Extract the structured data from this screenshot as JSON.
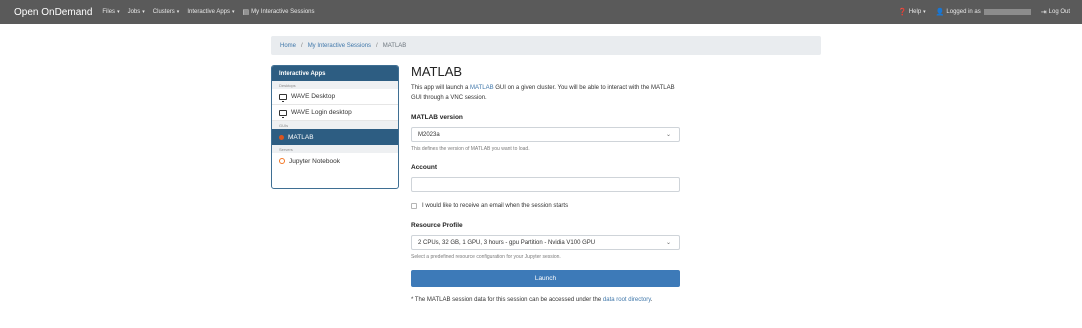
{
  "navbar": {
    "brand": "Open OnDemand",
    "menus": [
      "Files",
      "Jobs",
      "Clusters",
      "Interactive Apps"
    ],
    "sessions_link": "My Interactive Sessions",
    "help": "Help",
    "logged_in": "Logged in as",
    "logout": "Log Out"
  },
  "breadcrumb": {
    "home": "Home",
    "sessions": "My Interactive Sessions",
    "current": "MATLAB",
    "separator": "/"
  },
  "sidebar": {
    "header": "Interactive Apps",
    "groups": [
      {
        "category": "Desktops",
        "items": [
          {
            "label": "WAVE Desktop",
            "icon": "monitor-icon"
          },
          {
            "label": "WAVE Login desktop",
            "icon": "monitor-icon"
          }
        ]
      },
      {
        "category": "GUIs",
        "items": [
          {
            "label": "MATLAB",
            "icon": "matlab-icon",
            "active": true
          }
        ]
      },
      {
        "category": "Servers",
        "items": [
          {
            "label": "Jupyter Notebook",
            "icon": "jupyter-icon"
          }
        ]
      }
    ]
  },
  "form": {
    "title": "MATLAB",
    "description_pre": "This app will launch a ",
    "description_link": "MATLAB",
    "description_post": " GUI on a given cluster. You will be able to interact with the MATLAB GUI through a VNC session.",
    "version_label": "MATLAB version",
    "version_value": "M2023a",
    "version_help": "This defines the version of MATLAB you want to load.",
    "account_label": "Account",
    "account_value": "",
    "email_checkbox": "I would like to receive an email when the session starts",
    "profile_label": "Resource Profile",
    "profile_value": "2 CPUs, 32 GB, 1 GPU, 3 hours - gpu Partition - Nvidia V100 GPU",
    "profile_help": "Select a predefined resource configuration for your Jupyter session.",
    "launch": "Launch",
    "note_pre": "* The MATLAB session data for this session can be accessed under the ",
    "note_link": "data root directory",
    "note_post": "."
  },
  "colors": {
    "navbar": "#5a5a5a",
    "sidebar_active": "#2d5d82",
    "launch_button": "#3d7ab8",
    "link": "#3f77aa"
  }
}
